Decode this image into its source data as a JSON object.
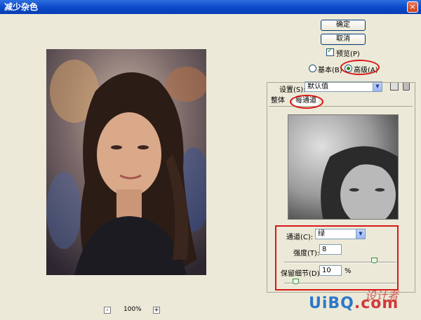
{
  "window": {
    "title": "减少杂色",
    "close_glyph": "×"
  },
  "buttons": {
    "ok": "确定",
    "cancel": "取消"
  },
  "preview_checkbox": {
    "label": "预览(P)",
    "checked": true,
    "mark": "✓"
  },
  "mode": {
    "basic": "基本(B)",
    "advanced": "高级(A)",
    "selected": "advanced"
  },
  "settings": {
    "label": "设置(S):",
    "value": "默认值",
    "arrow": "▼"
  },
  "tabs": {
    "overall": "整体",
    "per_channel": "每通道",
    "active": "per_channel"
  },
  "channel": {
    "label": "通道(C):",
    "value": "绿",
    "arrow": "▼"
  },
  "strength": {
    "label": "强度(T):",
    "value": "8",
    "slider_fraction": 0.8
  },
  "preserve": {
    "label": "保留细节(D):",
    "value": "10",
    "unit": "%",
    "slider_fraction": 0.1
  },
  "zoom": {
    "minus": "-",
    "plus": "+",
    "level": "100%"
  },
  "watermark": {
    "text_a": "UiBQ",
    "text_b": ".com",
    "text_cn": "设计者"
  },
  "colors": {
    "accent_red": "#d81818",
    "title_blue": "#0a48c8",
    "dialog_bg": "#ece9d8"
  }
}
